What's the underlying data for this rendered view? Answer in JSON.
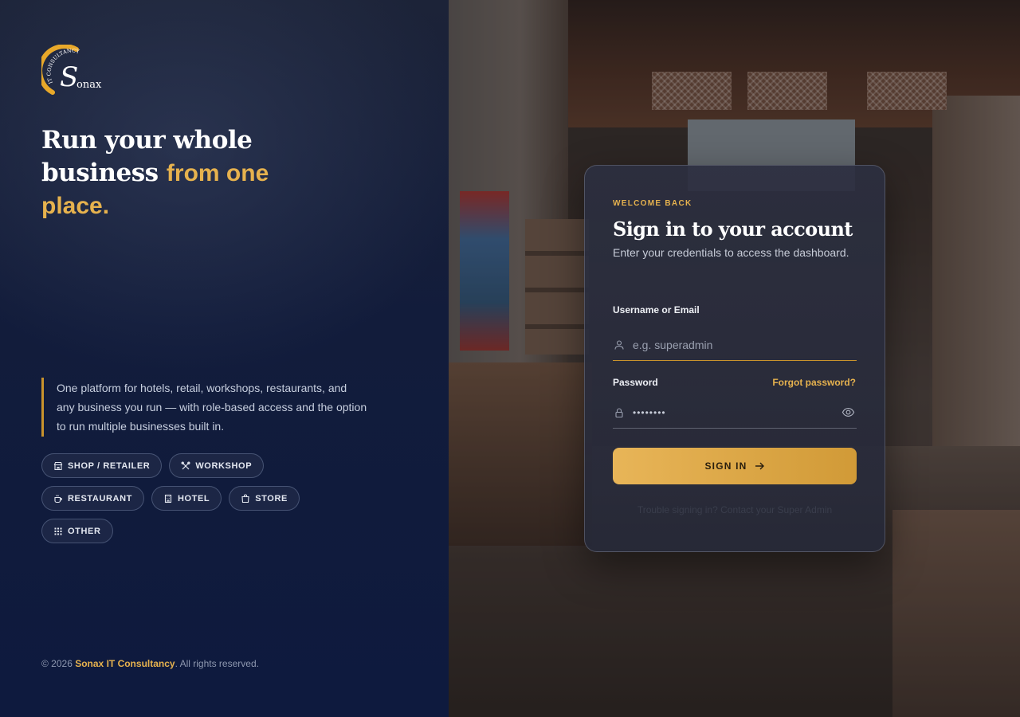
{
  "brand": {
    "logo_arc_text": "IT CONSULTANCY",
    "logo_name": "Sonax",
    "logo_initial": "S",
    "logo_rest": "onax"
  },
  "hero": {
    "line1": "Run your whole",
    "line2_plain": "business",
    "line2_accent": "from one",
    "line3_accent": "place."
  },
  "description": "One platform for hotels, retail, workshops, restaurants, and any business you run — with role-based access and the option to run multiple businesses built in.",
  "categories": [
    {
      "label": "SHOP / RETAILER",
      "icon": "store-front-icon"
    },
    {
      "label": "WORKSHOP",
      "icon": "tools-icon"
    },
    {
      "label": "RESTAURANT",
      "icon": "coffee-cup-icon"
    },
    {
      "label": "HOTEL",
      "icon": "building-icon"
    },
    {
      "label": "STORE",
      "icon": "shopping-bag-icon"
    },
    {
      "label": "OTHER",
      "icon": "grid-icon"
    }
  ],
  "footer": {
    "prefix": "© 2026 ",
    "brand": "Sonax IT Consultancy",
    "suffix": ". All rights reserved."
  },
  "login": {
    "eyebrow": "WELCOME BACK",
    "title": "Sign in to your account",
    "subtitle": "Enter your credentials to access the dashboard.",
    "username_label": "Username or Email",
    "username_placeholder": "e.g. superadmin",
    "username_value": "",
    "password_label": "Password",
    "password_value": "••••••••",
    "forgot_label": "Forgot password?",
    "submit_label": "SIGN IN",
    "trouble_text": "Trouble signing in? Contact your Super Admin"
  },
  "colors": {
    "accent": "#e6b24e",
    "panel_dark": "#121c3b",
    "card_bg": "#2c2f40"
  }
}
